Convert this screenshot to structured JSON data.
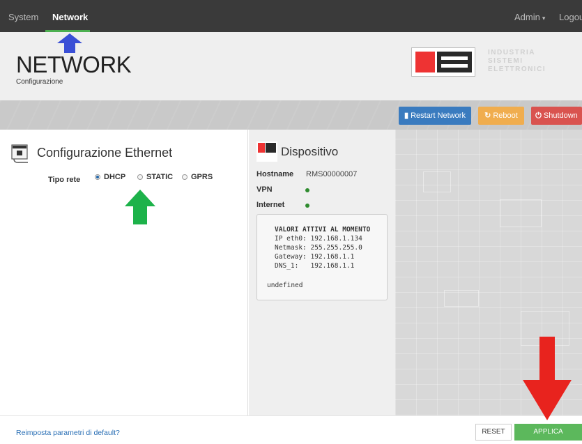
{
  "topnav": {
    "items": [
      "System",
      "Network"
    ],
    "active": "Network",
    "admin_label": "Admin",
    "logout_label": "Logout"
  },
  "header": {
    "title": "NETWORK",
    "subtitle": "Configurazione",
    "logo_text": [
      "INDUSTRIA",
      "SISTEMI",
      "ELETTRONICI"
    ]
  },
  "toolbar": {
    "restart_label": "Restart Network",
    "reboot_label": "Reboot",
    "shutdown_label": "Shutdown"
  },
  "ethernet": {
    "title": "Configurazione Ethernet",
    "tipo_label": "Tipo rete",
    "options": [
      "DHCP",
      "STATIC",
      "GPRS"
    ],
    "selected": "DHCP"
  },
  "device": {
    "title": "Dispositivo",
    "hostname_label": "Hostname",
    "hostname_value": "RMS00000007",
    "vpn_label": "VPN",
    "internet_label": "Internet",
    "box": {
      "heading": "VALORI ATTIVI AL MOMENTO",
      "lines": [
        "IP eth0: 192.168.1.134",
        "Netmask: 255.255.255.0",
        "Gateway: 192.168.1.1",
        "DNS_1:   192.168.1.1"
      ],
      "footer": "undefined"
    }
  },
  "footer": {
    "reset_link": "Reimposta parametri di default?",
    "reset_button": "RESET",
    "apply_button": "APPLICA"
  },
  "colors": {
    "nav_bg": "#3a3a3a",
    "active_underline": "#4caf50",
    "restart": "#3a7bbf",
    "reboot": "#f0ad4e",
    "shutdown": "#d9534f",
    "apply": "#5cb85c",
    "arrow_blue": "#3a4fd6",
    "arrow_green": "#1db24a",
    "arrow_red": "#e8231e"
  }
}
